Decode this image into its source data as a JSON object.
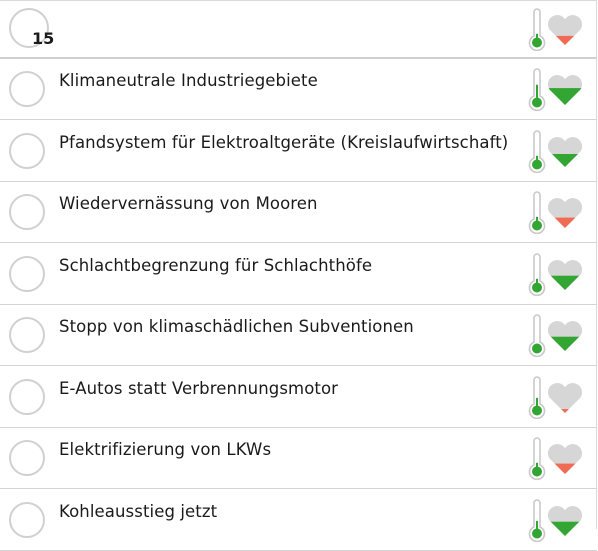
{
  "header": {
    "count": "15",
    "thermometer_level": 0.2,
    "heart": {
      "fill_level": 0.35,
      "color": "#f06a54"
    }
  },
  "colors": {
    "green": "#33a532",
    "red": "#f06a54",
    "gray": "#d6d6d6",
    "outline": "#c9c9c9"
  },
  "items": [
    {
      "label": "Klimaneutrale Industriegebiete",
      "thermometer_level": 0.55,
      "heart": {
        "fill_level": 0.65,
        "color": "#33a532"
      }
    },
    {
      "label": "Pfandsystem für Elektroaltgeräte (Kreislaufwirtschaft)",
      "thermometer_level": 0.2,
      "heart": {
        "fill_level": 0.5,
        "color": "#33a532"
      }
    },
    {
      "label": "Wiedervernässung von Mooren",
      "thermometer_level": 0.2,
      "heart": {
        "fill_level": 0.4,
        "color": "#f06a54"
      }
    },
    {
      "label": "Schlachtbegrenzung für Schlachthöfe",
      "thermometer_level": 0.2,
      "heart": {
        "fill_level": 0.55,
        "color": "#33a532"
      }
    },
    {
      "label": "Stopp von klimaschädlichen Subventionen",
      "thermometer_level": 0.0,
      "heart": {
        "fill_level": 0.55,
        "color": "#33a532"
      }
    },
    {
      "label": "E-Autos statt Verbrennungsmotor",
      "thermometer_level": 0.35,
      "heart": {
        "fill_level": 0.15,
        "color": "#f06a54"
      }
    },
    {
      "label": "Elektrifizierung von LKWs",
      "thermometer_level": 0.2,
      "heart": {
        "fill_level": 0.4,
        "color": "#f06a54"
      }
    },
    {
      "label": "Kohleausstieg jetzt",
      "thermometer_level": 0.35,
      "heart": {
        "fill_level": 0.55,
        "color": "#33a532"
      }
    }
  ]
}
